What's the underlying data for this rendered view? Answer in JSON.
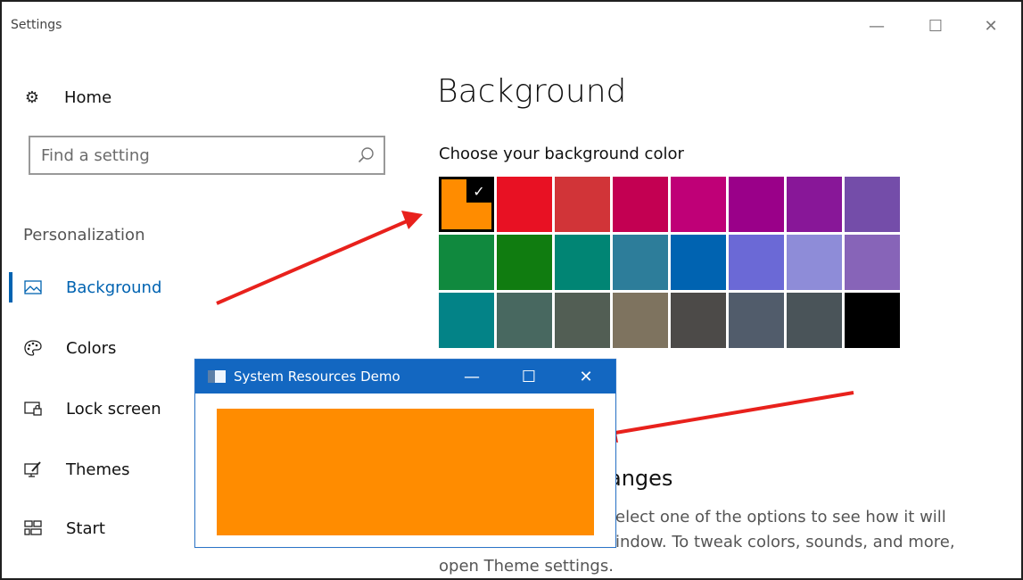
{
  "window": {
    "title": "Settings"
  },
  "window_controls": {
    "minimize": "—",
    "maximize": "☐",
    "close": "✕"
  },
  "sidebar": {
    "home_label": "Home",
    "search_placeholder": "Find a setting",
    "category": "Personalization",
    "items": [
      {
        "label": "Background",
        "icon": "picture-icon",
        "active": true
      },
      {
        "label": "Colors",
        "icon": "palette-icon",
        "active": false
      },
      {
        "label": "Lock screen",
        "icon": "lock-screen-icon",
        "active": false
      },
      {
        "label": "Themes",
        "icon": "brush-icon",
        "active": false
      },
      {
        "label": "Start",
        "icon": "start-tiles-icon",
        "active": false
      }
    ]
  },
  "main": {
    "heading": "Background",
    "subheading": "Choose your background color",
    "colors": [
      "#ff8c00",
      "#e81123",
      "#d13438",
      "#c30052",
      "#bf0077",
      "#9a0089",
      "#881798",
      "#744da9",
      "#10893e",
      "#107c10",
      "#018574",
      "#2d7d9a",
      "#0063b1",
      "#6b69d6",
      "#8e8cd8",
      "#8764b8",
      "#038387",
      "#486860",
      "#525e54",
      "#7e735f",
      "#4c4a48",
      "#515c6b",
      "#4a5459",
      "#000000"
    ],
    "selected_index": 0,
    "section_title_fragment": "anges",
    "paragraph_line1": "elect one of the options to see how it will",
    "paragraph_line2": "indow. To tweak colors, sounds, and more,",
    "paragraph_line3": "open Theme settings."
  },
  "demo_window": {
    "title": "System Resources Demo",
    "controls": {
      "minimize": "—",
      "maximize": "☐",
      "close": "✕"
    },
    "fill_color": "#ff8c00",
    "titlebar_color": "#1367c1"
  },
  "annotation_color": "#e8211c"
}
